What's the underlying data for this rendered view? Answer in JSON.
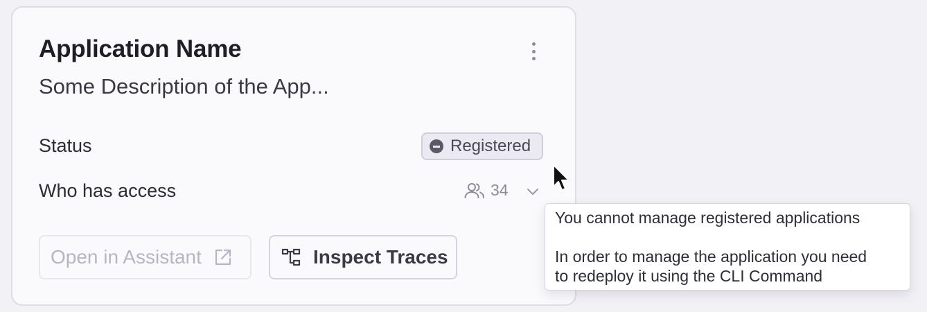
{
  "card": {
    "title": "Application Name",
    "description": "Some Description of the App...",
    "status_label": "Status",
    "status_badge": "Registered",
    "access_label": "Who has access",
    "access_count": "34",
    "buttons": {
      "open_assistant": "Open in Assistant",
      "inspect_traces": "Inspect Traces"
    },
    "icons": {
      "menu": "kebab-menu-icon",
      "status": "minus-circle-icon",
      "users": "users-icon",
      "expand": "chevron-down-icon",
      "external": "external-link-icon",
      "traces": "trace-tree-icon"
    }
  },
  "tooltip": {
    "line1": "You cannot manage registered applications",
    "line2": "In order to manage the application you need",
    "line3": "to redeploy it using the CLI Command"
  },
  "colors": {
    "background": "#f2f1f6",
    "card": "#fafafd",
    "badge_bg": "#ebeaf2",
    "muted": "#8d8b97"
  }
}
